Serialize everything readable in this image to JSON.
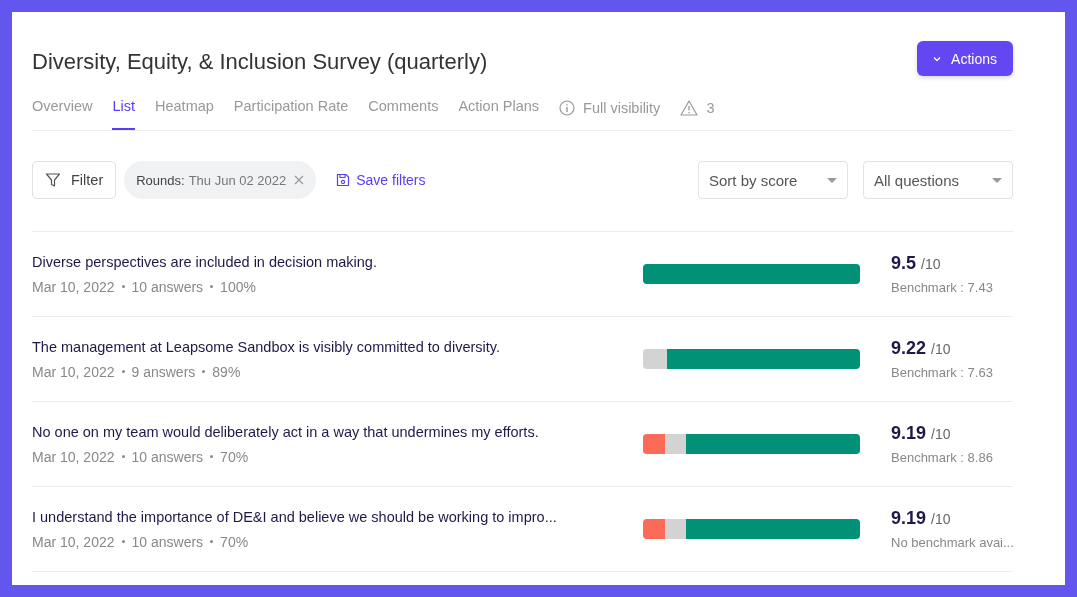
{
  "header": {
    "title": "Diversity, Equity, & Inclusion Survey (quarterly)",
    "actions_button": "Actions"
  },
  "tabs": [
    {
      "label": "Overview",
      "selected": false
    },
    {
      "label": "List",
      "selected": true
    },
    {
      "label": "Heatmap",
      "selected": false
    },
    {
      "label": "Participation Rate",
      "selected": false
    },
    {
      "label": "Comments",
      "selected": false
    },
    {
      "label": "Action Plans",
      "selected": false
    }
  ],
  "visibility": "Full visibility",
  "warnings": "3",
  "filters": {
    "filter_button": "Filter",
    "chip": {
      "label": "Rounds:",
      "value": "Thu Jun 02 2022"
    },
    "save_link": "Save filters",
    "sort": "Sort by score",
    "question_scope": "All questions"
  },
  "questions": [
    {
      "text": "Diverse perspectives are included in decision making.",
      "date": "Mar 10, 2022",
      "answers": "10 answers",
      "rate": "100%",
      "segments": [
        {
          "kind": "positive",
          "level": 1
        }
      ],
      "score": "9.5",
      "max": "/10",
      "benchmark": "Benchmark : 7.43"
    },
    {
      "text": "The management at Leapsome Sandbox is visibly committed to diversity.",
      "date": "Mar 10, 2022",
      "answers": "9 answers",
      "rate": "89%",
      "segments": [
        {
          "kind": "neutral",
          "level": 0.11
        },
        {
          "kind": "positive",
          "level": 0.89
        }
      ],
      "score": "9.22",
      "max": "/10",
      "benchmark": "Benchmark : 7.63"
    },
    {
      "text": "No one on my team would deliberately act in a way that undermines my efforts.",
      "date": "Mar 10, 2022",
      "answers": "10 answers",
      "rate": "70%",
      "segments": [
        {
          "kind": "negative",
          "level": 0.1
        },
        {
          "kind": "neutral",
          "level": 0.1
        },
        {
          "kind": "positive",
          "level": 0.8
        }
      ],
      "score": "9.19",
      "max": "/10",
      "benchmark": "Benchmark : 8.86"
    },
    {
      "text": "I understand the importance of DE&I and believe we should be working to impro...",
      "date": "Mar 10, 2022",
      "answers": "10 answers",
      "rate": "70%",
      "segments": [
        {
          "kind": "negative",
          "level": 0.1
        },
        {
          "kind": "neutral",
          "level": 0.1
        },
        {
          "kind": "positive",
          "level": 0.8
        }
      ],
      "score": "9.19",
      "max": "/10",
      "benchmark": "No benchmark avai..."
    }
  ]
}
